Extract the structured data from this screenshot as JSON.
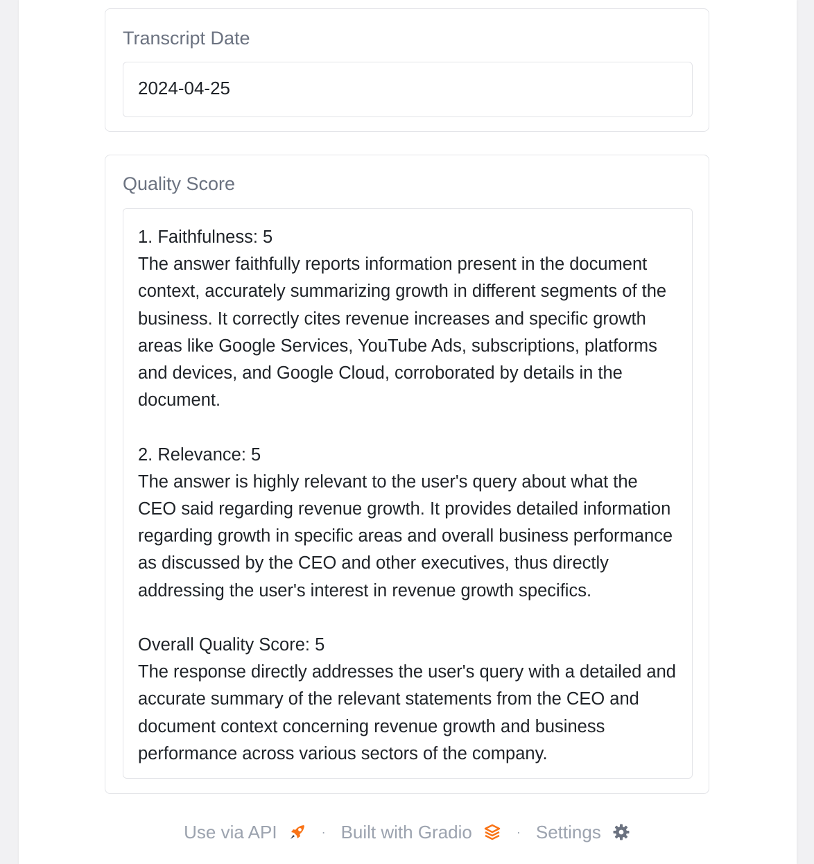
{
  "transcript_date": {
    "label": "Transcript Date",
    "value": "2024-04-25"
  },
  "quality_score": {
    "label": "Quality Score",
    "text": "1. Faithfulness: 5\nThe answer faithfully reports information present in the document context, accurately summarizing growth in different segments of the business. It correctly cites revenue increases and specific growth areas like Google Services, YouTube Ads, subscriptions, platforms and devices, and Google Cloud, corroborated by details in the document.\n\n2. Relevance: 5\nThe answer is highly relevant to the user's query about what the CEO said regarding revenue growth. It provides detailed information regarding growth in specific areas and overall business performance as discussed by the CEO and other executives, thus directly addressing the user's interest in revenue growth specifics.\n\nOverall Quality Score: 5\nThe response directly addresses the user's query with a detailed and accurate summary of the relevant statements from the CEO and document context concerning revenue growth and business performance across various sectors of the company."
  },
  "footer": {
    "api_label": "Use via API",
    "built_label": "Built with Gradio",
    "settings_label": "Settings",
    "separator": "·",
    "icons": [
      "rocket-icon",
      "gradio-logo-icon",
      "gear-icon"
    ],
    "accent_color": "#f97316"
  }
}
